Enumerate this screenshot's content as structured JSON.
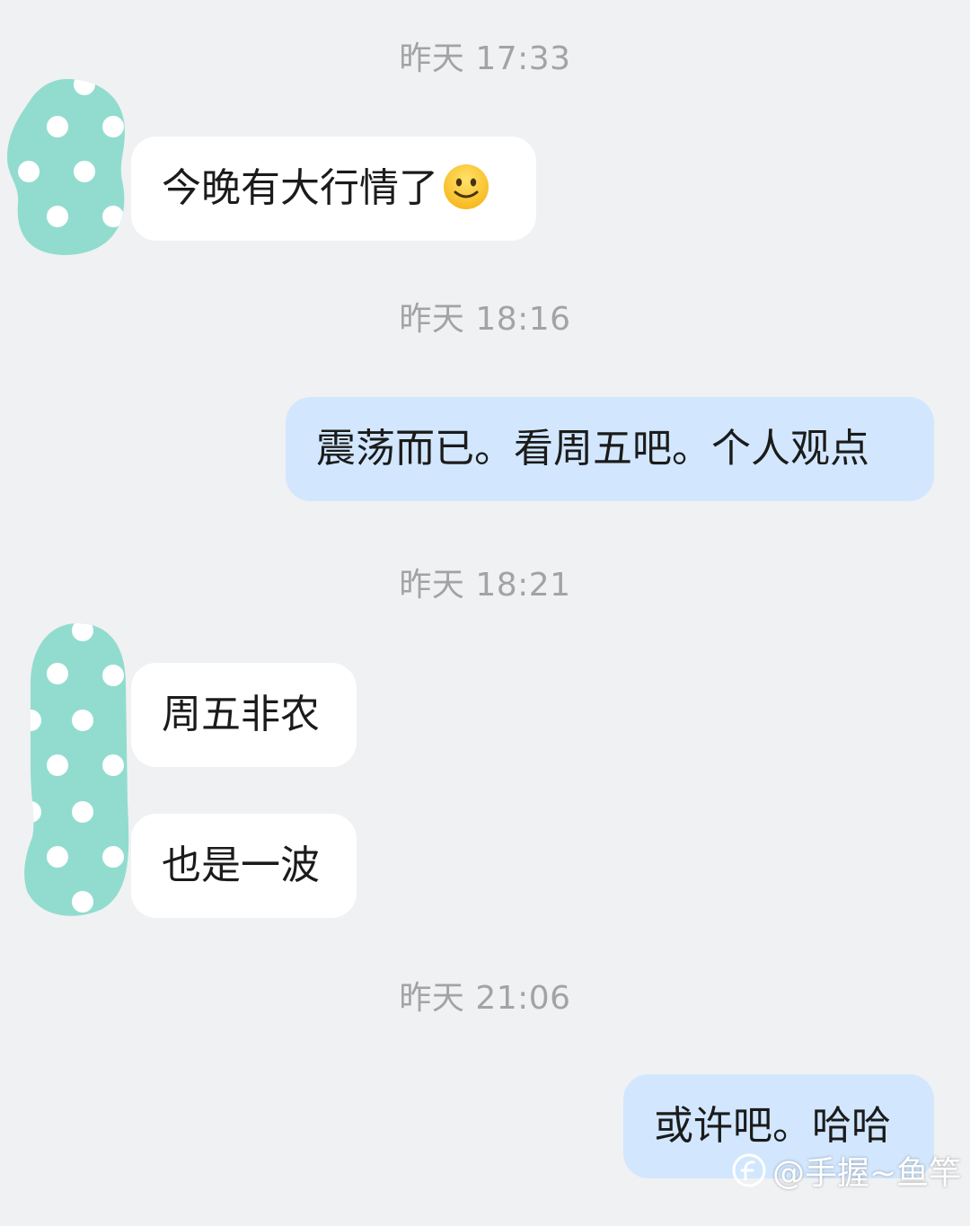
{
  "messages": {
    "m1": {
      "time": "昨天 17:33",
      "text": "今晚有大行情了"
    },
    "m2": {
      "time": "昨天 18:16",
      "text": "震荡而已。看周五吧。个人观点"
    },
    "m3": {
      "time": "昨天 18:21",
      "text1": "周五非农",
      "text2": "也是一波"
    },
    "m4": {
      "time": "昨天 21:06",
      "text": "或许吧。哈哈"
    }
  },
  "watermark": {
    "text": "@手握~鱼竿"
  },
  "colors": {
    "background": "#f0f1f3",
    "incoming_bubble": "#ffffff",
    "outgoing_bubble": "#d2e7fe",
    "avatar": "#92dccf",
    "timestamp": "#a3a3a3"
  },
  "icons": {
    "emoji": "slightly-smiling-face-icon",
    "avatar": "polka-dot-avatar"
  }
}
